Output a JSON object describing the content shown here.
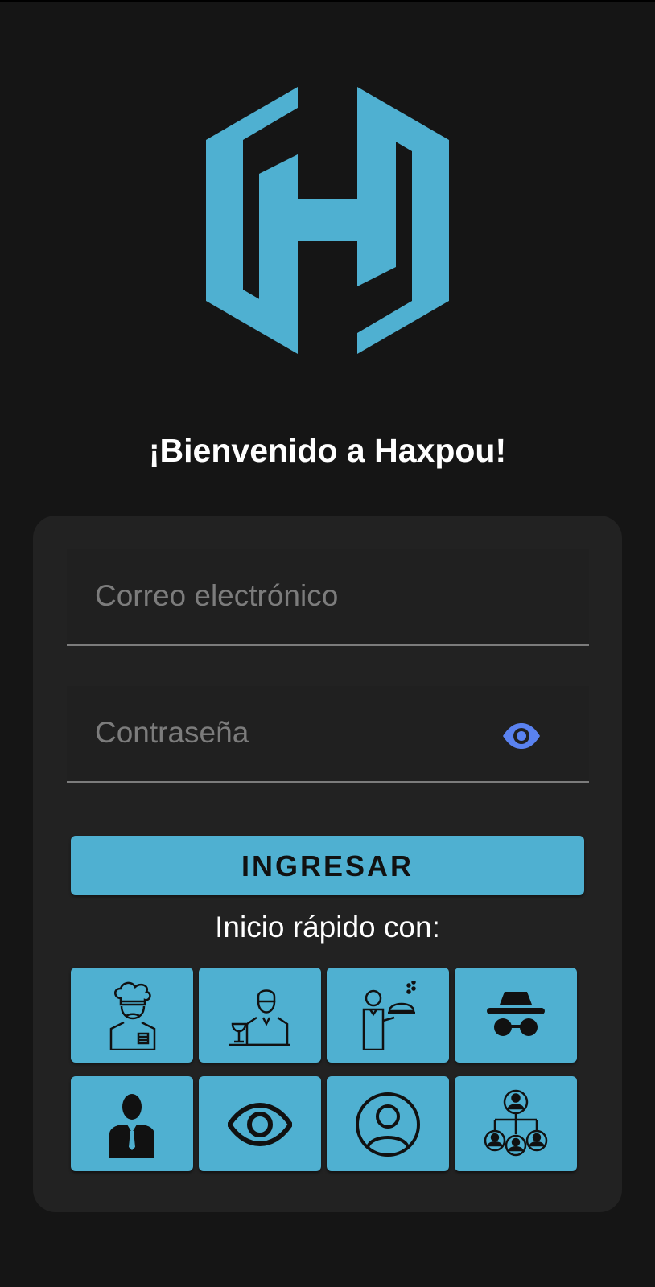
{
  "app": {
    "name": "Haxpou",
    "brand_color": "#4fb0d1",
    "background": "#151515"
  },
  "welcome": {
    "title": "¡Bienvenido a Haxpou!"
  },
  "login_form": {
    "email": {
      "placeholder": "Correo electrónico",
      "value": ""
    },
    "password": {
      "placeholder": "Contraseña",
      "value": "",
      "toggle_icon": "eye-icon",
      "toggle_color": "#5a82f0"
    },
    "submit_label": "INGRESAR"
  },
  "quick_start": {
    "label": "Inicio rápido con:",
    "options": [
      {
        "icon": "chef-icon"
      },
      {
        "icon": "bartender-icon"
      },
      {
        "icon": "waiter-icon"
      },
      {
        "icon": "incognito-icon"
      },
      {
        "icon": "businessman-icon"
      },
      {
        "icon": "eye-icon"
      },
      {
        "icon": "user-circle-icon"
      },
      {
        "icon": "user-network-icon"
      }
    ]
  }
}
